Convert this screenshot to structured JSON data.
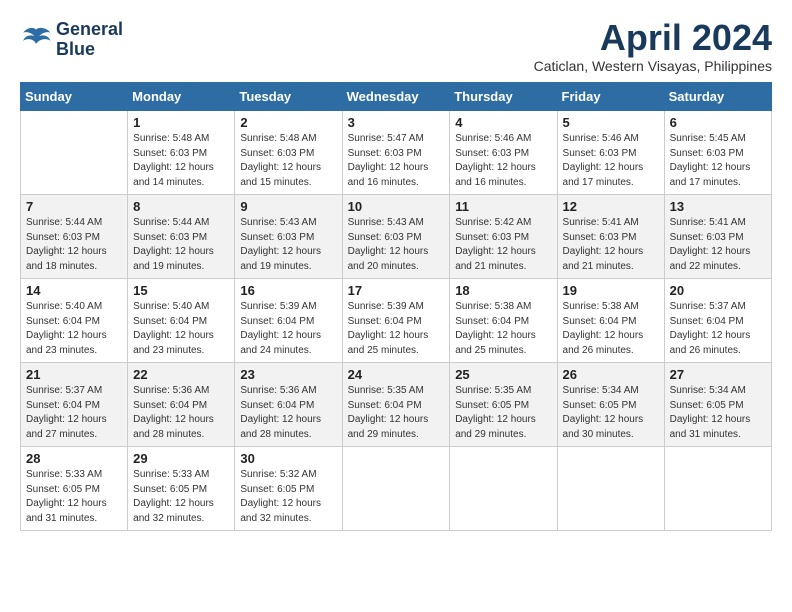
{
  "app": {
    "logo_line1": "General",
    "logo_line2": "Blue"
  },
  "header": {
    "month": "April 2024",
    "location": "Caticlan, Western Visayas, Philippines"
  },
  "days_of_week": [
    "Sunday",
    "Monday",
    "Tuesday",
    "Wednesday",
    "Thursday",
    "Friday",
    "Saturday"
  ],
  "weeks": [
    [
      {
        "day": "",
        "info": ""
      },
      {
        "day": "1",
        "info": "Sunrise: 5:48 AM\nSunset: 6:03 PM\nDaylight: 12 hours\nand 14 minutes."
      },
      {
        "day": "2",
        "info": "Sunrise: 5:48 AM\nSunset: 6:03 PM\nDaylight: 12 hours\nand 15 minutes."
      },
      {
        "day": "3",
        "info": "Sunrise: 5:47 AM\nSunset: 6:03 PM\nDaylight: 12 hours\nand 16 minutes."
      },
      {
        "day": "4",
        "info": "Sunrise: 5:46 AM\nSunset: 6:03 PM\nDaylight: 12 hours\nand 16 minutes."
      },
      {
        "day": "5",
        "info": "Sunrise: 5:46 AM\nSunset: 6:03 PM\nDaylight: 12 hours\nand 17 minutes."
      },
      {
        "day": "6",
        "info": "Sunrise: 5:45 AM\nSunset: 6:03 PM\nDaylight: 12 hours\nand 17 minutes."
      }
    ],
    [
      {
        "day": "7",
        "info": "Sunrise: 5:44 AM\nSunset: 6:03 PM\nDaylight: 12 hours\nand 18 minutes."
      },
      {
        "day": "8",
        "info": "Sunrise: 5:44 AM\nSunset: 6:03 PM\nDaylight: 12 hours\nand 19 minutes."
      },
      {
        "day": "9",
        "info": "Sunrise: 5:43 AM\nSunset: 6:03 PM\nDaylight: 12 hours\nand 19 minutes."
      },
      {
        "day": "10",
        "info": "Sunrise: 5:43 AM\nSunset: 6:03 PM\nDaylight: 12 hours\nand 20 minutes."
      },
      {
        "day": "11",
        "info": "Sunrise: 5:42 AM\nSunset: 6:03 PM\nDaylight: 12 hours\nand 21 minutes."
      },
      {
        "day": "12",
        "info": "Sunrise: 5:41 AM\nSunset: 6:03 PM\nDaylight: 12 hours\nand 21 minutes."
      },
      {
        "day": "13",
        "info": "Sunrise: 5:41 AM\nSunset: 6:03 PM\nDaylight: 12 hours\nand 22 minutes."
      }
    ],
    [
      {
        "day": "14",
        "info": "Sunrise: 5:40 AM\nSunset: 6:04 PM\nDaylight: 12 hours\nand 23 minutes."
      },
      {
        "day": "15",
        "info": "Sunrise: 5:40 AM\nSunset: 6:04 PM\nDaylight: 12 hours\nand 23 minutes."
      },
      {
        "day": "16",
        "info": "Sunrise: 5:39 AM\nSunset: 6:04 PM\nDaylight: 12 hours\nand 24 minutes."
      },
      {
        "day": "17",
        "info": "Sunrise: 5:39 AM\nSunset: 6:04 PM\nDaylight: 12 hours\nand 25 minutes."
      },
      {
        "day": "18",
        "info": "Sunrise: 5:38 AM\nSunset: 6:04 PM\nDaylight: 12 hours\nand 25 minutes."
      },
      {
        "day": "19",
        "info": "Sunrise: 5:38 AM\nSunset: 6:04 PM\nDaylight: 12 hours\nand 26 minutes."
      },
      {
        "day": "20",
        "info": "Sunrise: 5:37 AM\nSunset: 6:04 PM\nDaylight: 12 hours\nand 26 minutes."
      }
    ],
    [
      {
        "day": "21",
        "info": "Sunrise: 5:37 AM\nSunset: 6:04 PM\nDaylight: 12 hours\nand 27 minutes."
      },
      {
        "day": "22",
        "info": "Sunrise: 5:36 AM\nSunset: 6:04 PM\nDaylight: 12 hours\nand 28 minutes."
      },
      {
        "day": "23",
        "info": "Sunrise: 5:36 AM\nSunset: 6:04 PM\nDaylight: 12 hours\nand 28 minutes."
      },
      {
        "day": "24",
        "info": "Sunrise: 5:35 AM\nSunset: 6:04 PM\nDaylight: 12 hours\nand 29 minutes."
      },
      {
        "day": "25",
        "info": "Sunrise: 5:35 AM\nSunset: 6:05 PM\nDaylight: 12 hours\nand 29 minutes."
      },
      {
        "day": "26",
        "info": "Sunrise: 5:34 AM\nSunset: 6:05 PM\nDaylight: 12 hours\nand 30 minutes."
      },
      {
        "day": "27",
        "info": "Sunrise: 5:34 AM\nSunset: 6:05 PM\nDaylight: 12 hours\nand 31 minutes."
      }
    ],
    [
      {
        "day": "28",
        "info": "Sunrise: 5:33 AM\nSunset: 6:05 PM\nDaylight: 12 hours\nand 31 minutes."
      },
      {
        "day": "29",
        "info": "Sunrise: 5:33 AM\nSunset: 6:05 PM\nDaylight: 12 hours\nand 32 minutes."
      },
      {
        "day": "30",
        "info": "Sunrise: 5:32 AM\nSunset: 6:05 PM\nDaylight: 12 hours\nand 32 minutes."
      },
      {
        "day": "",
        "info": ""
      },
      {
        "day": "",
        "info": ""
      },
      {
        "day": "",
        "info": ""
      },
      {
        "day": "",
        "info": ""
      }
    ]
  ]
}
